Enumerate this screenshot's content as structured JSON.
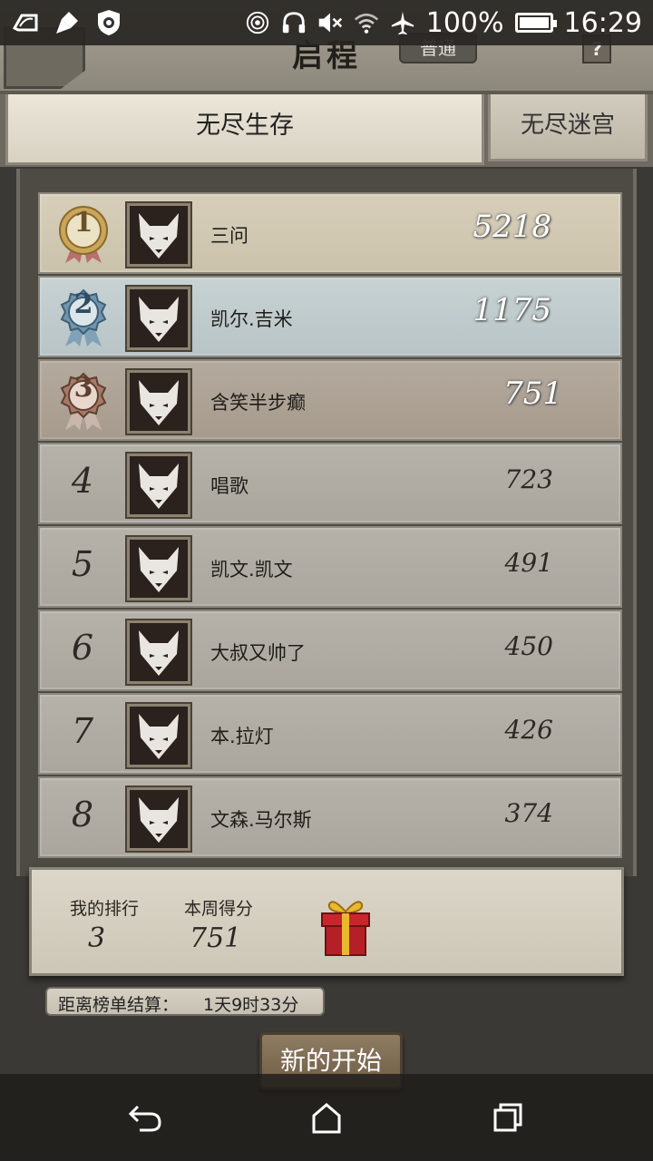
{
  "status_bar": {
    "battery": "100%",
    "time": "16:29",
    "left_icons": [
      "notification-icon",
      "cleaner-icon",
      "settings-shield-icon"
    ],
    "right_icons": [
      "hotspot-icon",
      "headset-icon",
      "mute-icon",
      "wifi-icon",
      "airplane-icon",
      "battery-icon"
    ]
  },
  "header": {
    "title": "启程",
    "mode": "普通",
    "help": "?"
  },
  "tabs": [
    {
      "label": "无尽生存",
      "active": true
    },
    {
      "label": "无尽迷宫",
      "active": false
    }
  ],
  "leaderboard": [
    {
      "rank": "1",
      "name": "三问",
      "score": "5218"
    },
    {
      "rank": "2",
      "name": "凯尔.吉米",
      "score": "1175"
    },
    {
      "rank": "3",
      "name": "含笑半步癫",
      "score": "751"
    },
    {
      "rank": "4",
      "name": "唱歌",
      "score": "723"
    },
    {
      "rank": "5",
      "name": "凯文.凯文",
      "score": "491"
    },
    {
      "rank": "6",
      "name": "大叔又帅了",
      "score": "450"
    },
    {
      "rank": "7",
      "name": "本.拉灯",
      "score": "426"
    },
    {
      "rank": "8",
      "name": "文森.马尔斯",
      "score": "374"
    }
  ],
  "my_stats": {
    "rank_label": "我的排行",
    "rank_value": "3",
    "score_label": "本周得分",
    "score_value": "751"
  },
  "countdown": {
    "label": "距离榜单结算：",
    "value": "1天9时33分"
  },
  "start_button": "新的开始",
  "colors": {
    "gold": "#c9a65a",
    "silver": "#7fa2b8",
    "bronze": "#a77a66"
  }
}
